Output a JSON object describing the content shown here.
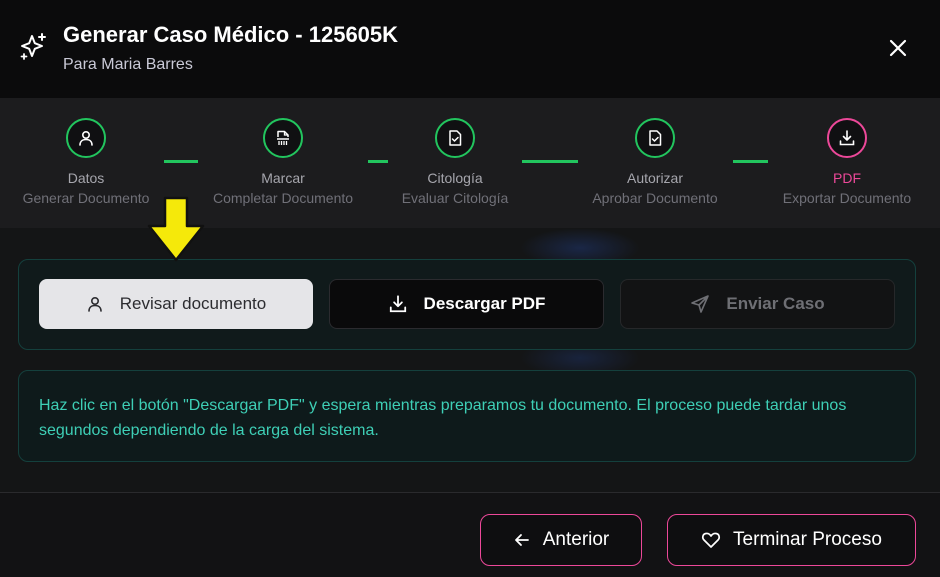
{
  "header": {
    "title": "Generar Caso Médico - 125605K",
    "subtitle": "Para Maria Barres",
    "icon": "sparkles-icon",
    "close_icon": "close-icon"
  },
  "steps": [
    {
      "label": "Datos",
      "sub": "Generar Documento",
      "icon": "user-icon",
      "state": "complete"
    },
    {
      "label": "Marcar",
      "sub": "Completar Documento",
      "icon": "document-fingerprint-icon",
      "state": "complete"
    },
    {
      "label": "Citología",
      "sub": "Evaluar Citología",
      "icon": "file-check-icon",
      "state": "complete"
    },
    {
      "label": "Autorizar",
      "sub": "Aprobar Documento",
      "icon": "file-check-icon",
      "state": "complete"
    },
    {
      "label": "PDF",
      "sub": "Exportar Documento",
      "icon": "download-icon",
      "state": "active"
    }
  ],
  "actions": {
    "review": "Revisar documento",
    "download": "Descargar PDF",
    "send": "Enviar Caso"
  },
  "info": "Haz clic en el botón \"Descargar PDF\" y espera mientras preparamos tu documento. El proceso puede tardar unos segundos dependiendo de la carga del sistema.",
  "footer": {
    "prev": "Anterior",
    "finish": "Terminar Proceso"
  },
  "colors": {
    "complete": "#22c55e",
    "active": "#ec4899",
    "info_text": "#3ecfb6",
    "pointer_arrow": "#f5e90a"
  }
}
